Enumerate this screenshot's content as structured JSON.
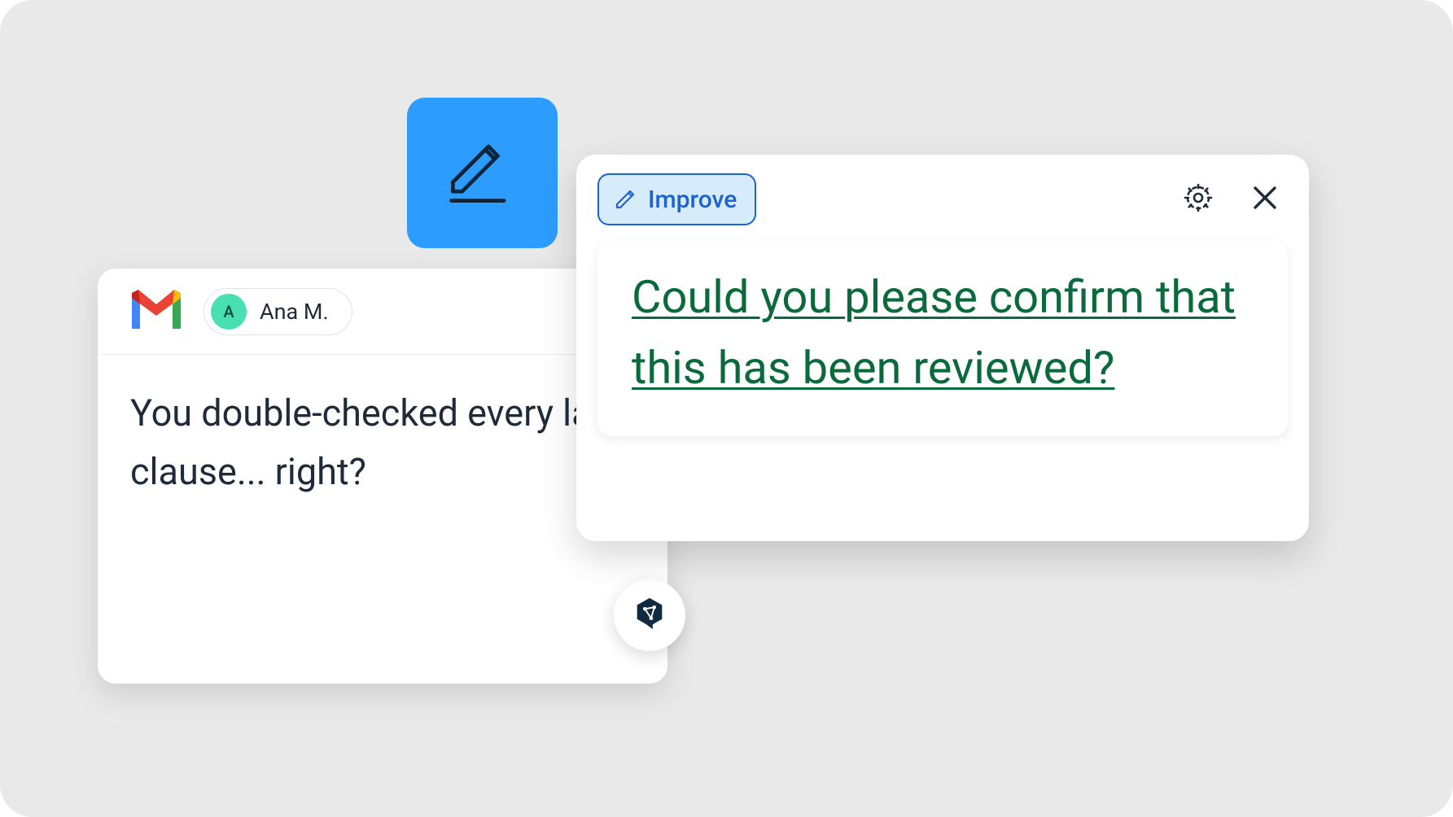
{
  "edit_tile": {
    "icon": "pencil-icon"
  },
  "email": {
    "service_icon": "gmail-icon",
    "sender": {
      "initial": "A",
      "name": "Ana M."
    },
    "body": "You double-checked every last clause... right?",
    "floating_button_icon": "share-hex-icon"
  },
  "suggestion": {
    "improve_button_label": "Improve",
    "settings_icon": "gear-icon",
    "close_icon": "close-icon",
    "text": "Could you please confirm that this has been reviewed?"
  }
}
